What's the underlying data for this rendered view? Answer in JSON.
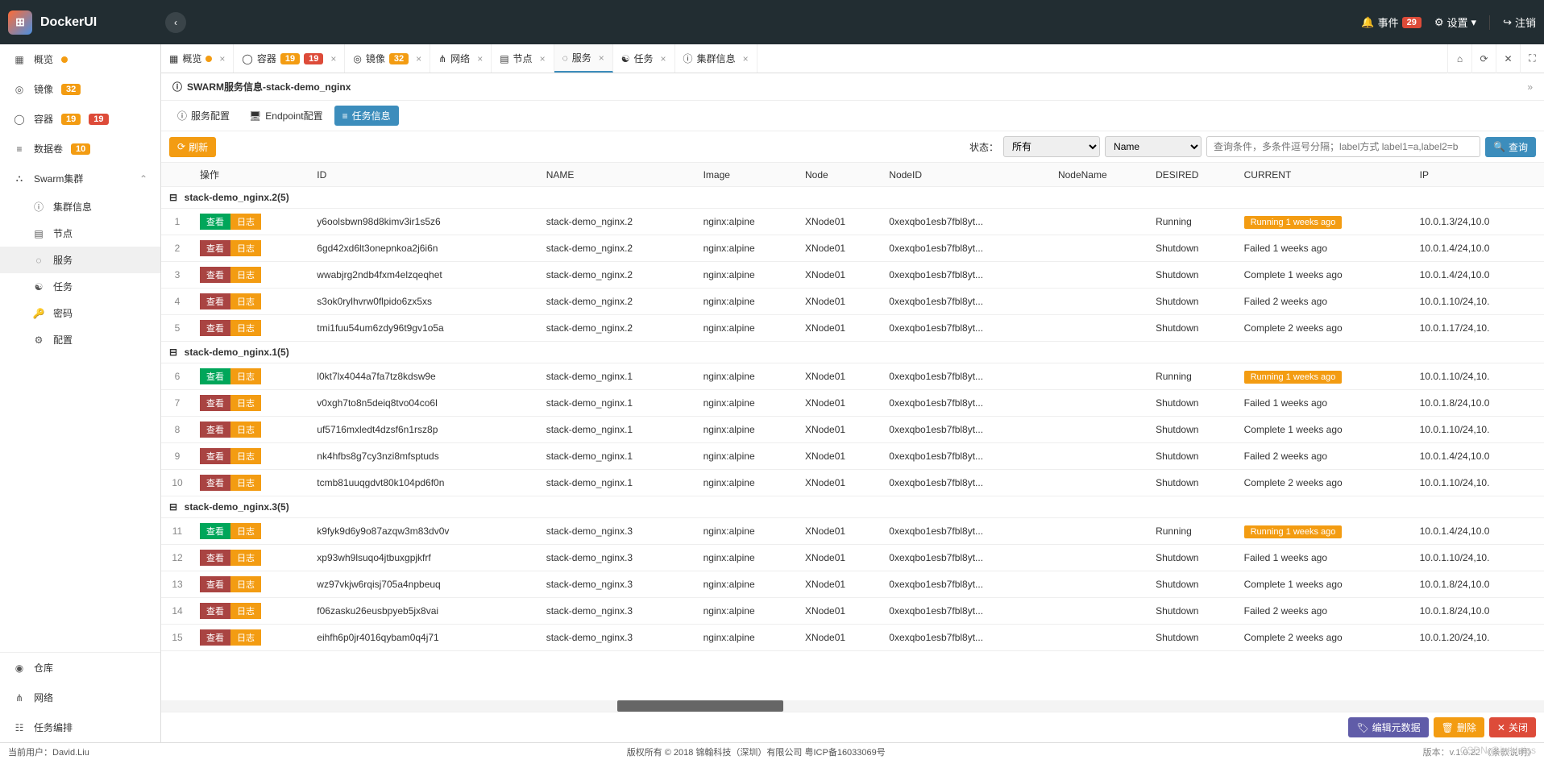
{
  "brand": "DockerUI",
  "topbar": {
    "events_label": "事件",
    "events_count": "29",
    "settings_label": "设置",
    "logout_label": "注销"
  },
  "sidebar": {
    "items": [
      {
        "icon": "▦",
        "label": "概览",
        "dot": true
      },
      {
        "icon": "◎",
        "label": "镜像",
        "badges": [
          "32"
        ]
      },
      {
        "icon": "◯",
        "label": "容器",
        "badges": [
          "19",
          "19"
        ]
      },
      {
        "icon": "≡",
        "label": "数据卷",
        "badges": [
          "10"
        ]
      },
      {
        "icon": "⛬",
        "label": "Swarm集群",
        "expandable": true
      }
    ],
    "sub": [
      {
        "icon": "ⓘ",
        "label": "集群信息"
      },
      {
        "icon": "▤",
        "label": "节点"
      },
      {
        "icon": "◌",
        "label": "服务",
        "active": true
      },
      {
        "icon": "☯",
        "label": "任务"
      },
      {
        "icon": "🔑",
        "label": "密码"
      },
      {
        "icon": "⚙",
        "label": "配置"
      }
    ],
    "bottom": [
      {
        "icon": "◉",
        "label": "仓库"
      },
      {
        "icon": "⋔",
        "label": "网络"
      },
      {
        "icon": "☷",
        "label": "任务编排"
      }
    ]
  },
  "tabs": {
    "items": [
      {
        "icon": "▦",
        "label": "概览",
        "dot": true
      },
      {
        "icon": "◯",
        "label": "容器",
        "badges": [
          "19",
          "19"
        ]
      },
      {
        "icon": "◎",
        "label": "镜像",
        "badges": [
          "32"
        ]
      },
      {
        "icon": "⋔",
        "label": "网络"
      },
      {
        "icon": "▤",
        "label": "节点"
      },
      {
        "icon": "◌",
        "label": "服务",
        "active": true
      },
      {
        "icon": "☯",
        "label": "任务"
      },
      {
        "icon": "ⓘ",
        "label": "集群信息"
      }
    ]
  },
  "breadcrumb": {
    "title": "SWARM服务信息-stack-demo_nginx"
  },
  "subtabs": {
    "items": [
      {
        "icon": "ⓘ",
        "label": "服务配置"
      },
      {
        "icon": "🖥",
        "label": "Endpoint配置"
      },
      {
        "icon": "≡",
        "label": "任务信息",
        "active": true
      }
    ]
  },
  "toolbar": {
    "refresh": "刷新",
    "state_label": "状态：",
    "state_value": "所有",
    "sort_value": "Name",
    "search_placeholder": "查询条件，多条件逗号分隔；label方式 label1=a,label2=b",
    "search_btn": "查询"
  },
  "columns": [
    "",
    "操作",
    "ID",
    "NAME",
    "Image",
    "Node",
    "NodeID",
    "NodeName",
    "DESIRED",
    "CURRENT",
    "IP"
  ],
  "view_label": "查看",
  "log_label": "日志",
  "groups": [
    {
      "title": "stack-demo_nginx.2(5)",
      "rows": [
        {
          "n": "1",
          "green": true,
          "id": "y6oolsbwn98d8kimv3ir1s5z6",
          "name": "stack-demo_nginx.2",
          "image": "nginx:alpine",
          "node": "XNode01",
          "nodeid": "0xexqbo1esb7fbl8yt...",
          "desired": "Running",
          "current": "Running 1 weeks ago",
          "tag": true,
          "ip": "10.0.1.3/24,10.0"
        },
        {
          "n": "2",
          "id": "6gd42xd6lt3onepnkoa2j6i6n",
          "name": "stack-demo_nginx.2",
          "image": "nginx:alpine",
          "node": "XNode01",
          "nodeid": "0xexqbo1esb7fbl8yt...",
          "desired": "Shutdown",
          "current": "Failed 1 weeks ago",
          "ip": "10.0.1.4/24,10.0"
        },
        {
          "n": "3",
          "id": "wwabjrg2ndb4fxm4elzqeqhet",
          "name": "stack-demo_nginx.2",
          "image": "nginx:alpine",
          "node": "XNode01",
          "nodeid": "0xexqbo1esb7fbl8yt...",
          "desired": "Shutdown",
          "current": "Complete 1 weeks ago",
          "ip": "10.0.1.4/24,10.0"
        },
        {
          "n": "4",
          "id": "s3ok0rylhvrw0flpido6zx5xs",
          "name": "stack-demo_nginx.2",
          "image": "nginx:alpine",
          "node": "XNode01",
          "nodeid": "0xexqbo1esb7fbl8yt...",
          "desired": "Shutdown",
          "current": "Failed 2 weeks ago",
          "ip": "10.0.1.10/24,10."
        },
        {
          "n": "5",
          "id": "tmi1fuu54um6zdy96t9gv1o5a",
          "name": "stack-demo_nginx.2",
          "image": "nginx:alpine",
          "node": "XNode01",
          "nodeid": "0xexqbo1esb7fbl8yt...",
          "desired": "Shutdown",
          "current": "Complete 2 weeks ago",
          "ip": "10.0.1.17/24,10."
        }
      ]
    },
    {
      "title": "stack-demo_nginx.1(5)",
      "rows": [
        {
          "n": "6",
          "green": true,
          "id": "l0kt7lx4044a7fa7tz8kdsw9e",
          "name": "stack-demo_nginx.1",
          "image": "nginx:alpine",
          "node": "XNode01",
          "nodeid": "0xexqbo1esb7fbl8yt...",
          "desired": "Running",
          "current": "Running 1 weeks ago",
          "tag": true,
          "ip": "10.0.1.10/24,10."
        },
        {
          "n": "7",
          "id": "v0xgh7to8n5deiq8tvo04co6l",
          "name": "stack-demo_nginx.1",
          "image": "nginx:alpine",
          "node": "XNode01",
          "nodeid": "0xexqbo1esb7fbl8yt...",
          "desired": "Shutdown",
          "current": "Failed 1 weeks ago",
          "ip": "10.0.1.8/24,10.0"
        },
        {
          "n": "8",
          "id": "uf5716mxledt4dzsf6n1rsz8p",
          "name": "stack-demo_nginx.1",
          "image": "nginx:alpine",
          "node": "XNode01",
          "nodeid": "0xexqbo1esb7fbl8yt...",
          "desired": "Shutdown",
          "current": "Complete 1 weeks ago",
          "ip": "10.0.1.10/24,10."
        },
        {
          "n": "9",
          "id": "nk4hfbs8g7cy3nzi8mfsptuds",
          "name": "stack-demo_nginx.1",
          "image": "nginx:alpine",
          "node": "XNode01",
          "nodeid": "0xexqbo1esb7fbl8yt...",
          "desired": "Shutdown",
          "current": "Failed 2 weeks ago",
          "ip": "10.0.1.4/24,10.0"
        },
        {
          "n": "10",
          "id": "tcmb81uuqgdvt80k104pd6f0n",
          "name": "stack-demo_nginx.1",
          "image": "nginx:alpine",
          "node": "XNode01",
          "nodeid": "0xexqbo1esb7fbl8yt...",
          "desired": "Shutdown",
          "current": "Complete 2 weeks ago",
          "ip": "10.0.1.10/24,10."
        }
      ]
    },
    {
      "title": "stack-demo_nginx.3(5)",
      "rows": [
        {
          "n": "11",
          "green": true,
          "id": "k9fyk9d6y9o87azqw3m83dv0v",
          "name": "stack-demo_nginx.3",
          "image": "nginx:alpine",
          "node": "XNode01",
          "nodeid": "0xexqbo1esb7fbl8yt...",
          "desired": "Running",
          "current": "Running 1 weeks ago",
          "tag": true,
          "ip": "10.0.1.4/24,10.0"
        },
        {
          "n": "12",
          "id": "xp93wh9lsuqo4jtbuxgpjkfrf",
          "name": "stack-demo_nginx.3",
          "image": "nginx:alpine",
          "node": "XNode01",
          "nodeid": "0xexqbo1esb7fbl8yt...",
          "desired": "Shutdown",
          "current": "Failed 1 weeks ago",
          "ip": "10.0.1.10/24,10."
        },
        {
          "n": "13",
          "id": "wz97vkjw6rqisj705a4npbeuq",
          "name": "stack-demo_nginx.3",
          "image": "nginx:alpine",
          "node": "XNode01",
          "nodeid": "0xexqbo1esb7fbl8yt...",
          "desired": "Shutdown",
          "current": "Complete 1 weeks ago",
          "ip": "10.0.1.8/24,10.0"
        },
        {
          "n": "14",
          "id": "f06zasku26eusbpyeb5jx8vai",
          "name": "stack-demo_nginx.3",
          "image": "nginx:alpine",
          "node": "XNode01",
          "nodeid": "0xexqbo1esb7fbl8yt...",
          "desired": "Shutdown",
          "current": "Failed 2 weeks ago",
          "ip": "10.0.1.8/24,10.0"
        },
        {
          "n": "15",
          "id": "eihfh6p0jr4016qybam0q4j71",
          "name": "stack-demo_nginx.3",
          "image": "nginx:alpine",
          "node": "XNode01",
          "nodeid": "0xexqbo1esb7fbl8yt...",
          "desired": "Shutdown",
          "current": "Complete 2 weeks ago",
          "ip": "10.0.1.20/24,10."
        }
      ]
    }
  ],
  "actions": {
    "edit": "编辑元数据",
    "delete": "删除",
    "close": "关闭"
  },
  "footer": {
    "left": "当前用户：David.Liu",
    "center": "版权所有 © 2018 锦翰科技（深圳）有限公司 粤ICP备16033069号",
    "right": "版本：v.1.0.22 《条款说明》"
  },
  "watermark": "CSDN @inthirties"
}
